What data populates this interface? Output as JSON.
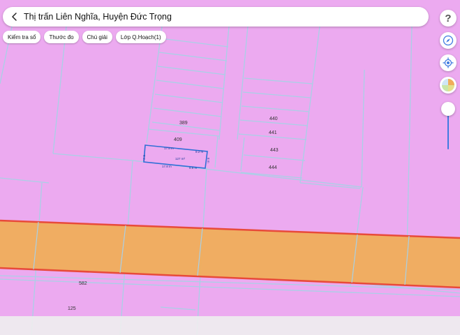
{
  "header": {
    "back_icon": "chevron-left-icon",
    "title": "Thị trấn Liên Nghĩa, Huyện Đức Trọng"
  },
  "chips": [
    {
      "label": "Kiểm tra sổ"
    },
    {
      "label": "Thước đo"
    },
    {
      "label": "Chú giải"
    },
    {
      "label": "Lớp Q.Hoạch(1)"
    }
  ],
  "side_controls": {
    "help": "?",
    "icons": [
      "help-icon",
      "compass-icon",
      "locate-icon",
      "map-layer-icon",
      "opacity-slider"
    ]
  },
  "map": {
    "colors": {
      "residential_land": "#ecaaf0",
      "planned_road": "#f0ad5a",
      "road_border": "#e84a3a",
      "parcel_line": "#a9d0e6",
      "selected_parcel": "#2f6fd6"
    },
    "parcel_labels": {
      "p389": "389",
      "p409": "409",
      "p440": "440",
      "p441": "441",
      "p443": "443",
      "p444": "444",
      "p582": "582",
      "p125": "125"
    },
    "selected_parcel": {
      "area": "127 m²",
      "top_edge": "17.8 m",
      "right_top": "8.2 m",
      "right_side": "8 m",
      "left_side": "8 m",
      "bottom_left": "17.8 m",
      "bottom_right": "8.8 m"
    }
  }
}
